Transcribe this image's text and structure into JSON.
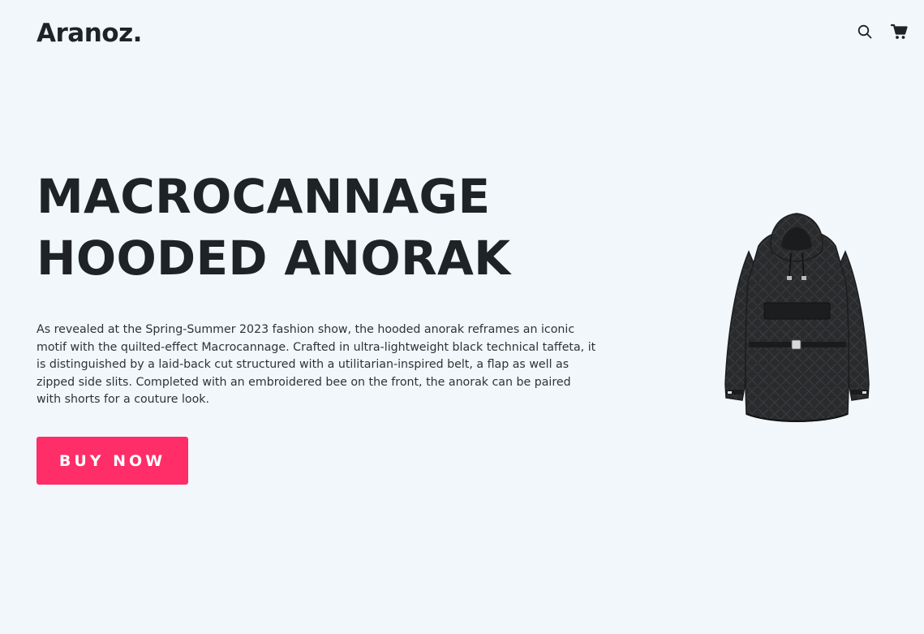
{
  "header": {
    "brand": "Aranoz.",
    "icons": [
      "search-icon",
      "cart-icon"
    ]
  },
  "hero": {
    "title_line1": "MACROCANNAGE",
    "title_line2": "HOODED ANORAK",
    "description": "As revealed at the Spring-Summer 2023 fashion show, the hooded anorak reframes an iconic motif with the quilted-effect Macrocannage. Crafted in ultra-lightweight black technical taffeta, it is distinguished by a laid-back cut structured with a utilitarian-inspired belt, a flap as well as zipped side slits. Completed with an embroidered bee on the front, the anorak can be paired with shorts for a couture look.",
    "button_label": "BUY NOW"
  },
  "colors": {
    "background": "#f1f7fa",
    "text": "#1f2326",
    "accent": "#ff2d68"
  }
}
